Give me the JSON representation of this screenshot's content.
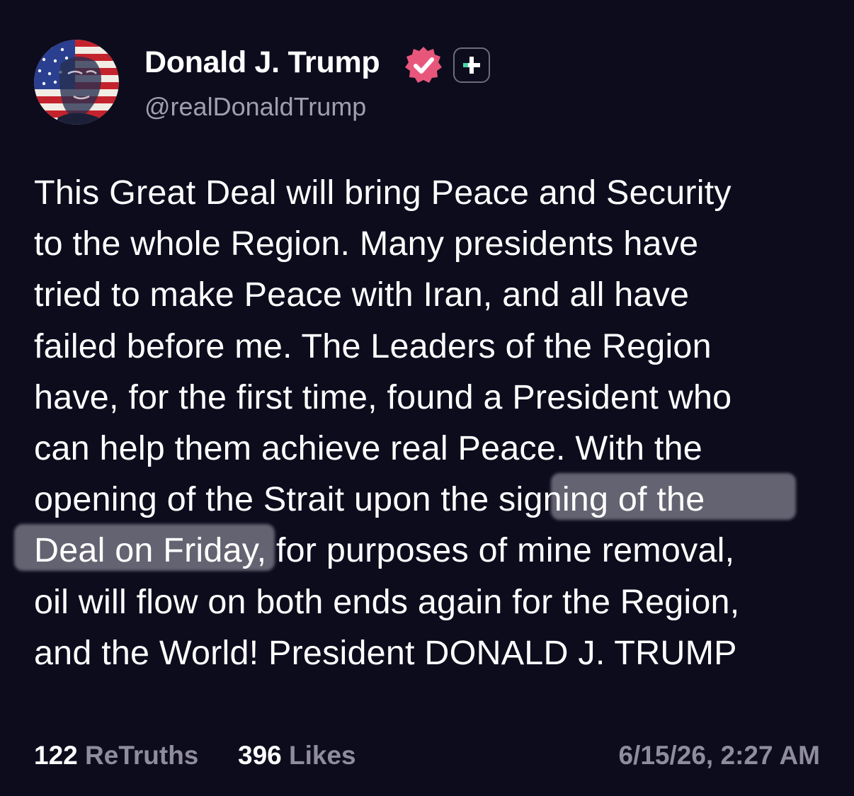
{
  "author": {
    "display_name": "Donald J. Trump",
    "handle": "@realDonaldTrump",
    "verified": true,
    "verified_badge_color": "#e8577b",
    "avatar_icon": "flag-portrait-avatar",
    "plus_badge_icon": "plus-icon"
  },
  "post": {
    "text": "This Great Deal will bring Peace and Security\nto the whole Region. Many presidents have\ntried to make Peace with Iran, and all have\nfailed before me. The Leaders of the Region\nhave, for the first time, found a President who\ncan help them achieve real Peace. With the\nopening of the Strait upon the signing of the\nDeal on Friday, for purposes of mine removal,\noil will flow on both ends again for the Region,\nand the World! President DONALD J. TRUMP",
    "highlighted_phrases": [
      "signing of the",
      "Deal on Friday"
    ]
  },
  "stats": {
    "retruths_count": "122",
    "retruths_label": "ReTruths",
    "likes_count": "396",
    "likes_label": "Likes"
  },
  "timestamp": "6/15/26, 2:27 AM",
  "colors": {
    "background": "#0d0c1d",
    "text": "#ffffff",
    "muted": "#8f8d9c",
    "accent_green": "#47d7a5",
    "highlight": "#dedee6"
  }
}
